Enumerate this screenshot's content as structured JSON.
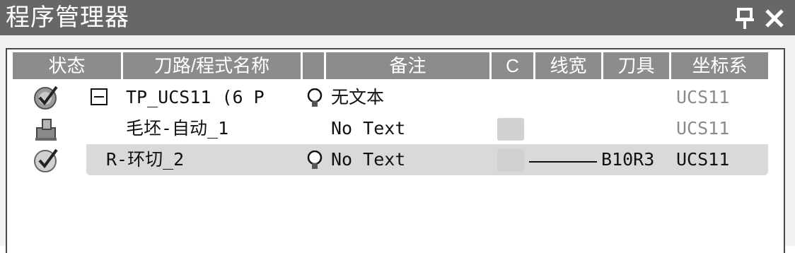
{
  "window": {
    "title": "程序管理器",
    "pin_icon": "pin-icon",
    "close_icon": "close-icon"
  },
  "columns": [
    "状态",
    "刀路/程式名称",
    "",
    "备注",
    "C",
    "线宽",
    "刀具",
    "坐标系"
  ],
  "rows": [
    {
      "status_icon": "program-check-icon",
      "expand": "collapse-minus-icon",
      "name": "TP_UCS11 (6 P",
      "bulb": true,
      "note": "无文本",
      "c_box": false,
      "linewidth": false,
      "tool": "",
      "ucs": "UCS11",
      "selected": false
    },
    {
      "status_icon": "stock-block-icon",
      "expand": "",
      "name": "毛坯-自动_1",
      "bulb": false,
      "note": "No Text",
      "c_box": true,
      "linewidth": false,
      "tool": "",
      "ucs": "UCS11",
      "selected": false
    },
    {
      "status_icon": "operation-check-icon",
      "expand": "",
      "name": "R-环切_2",
      "bulb": true,
      "note": "No Text",
      "c_box": true,
      "linewidth": true,
      "tool": "B10R3",
      "ucs": "UCS11",
      "selected": true
    }
  ],
  "colors": {
    "titlebar": "#676767",
    "header": "#8c8c8c",
    "selected_row": "#d9d9d9",
    "muted_text": "#8a8a8a"
  }
}
